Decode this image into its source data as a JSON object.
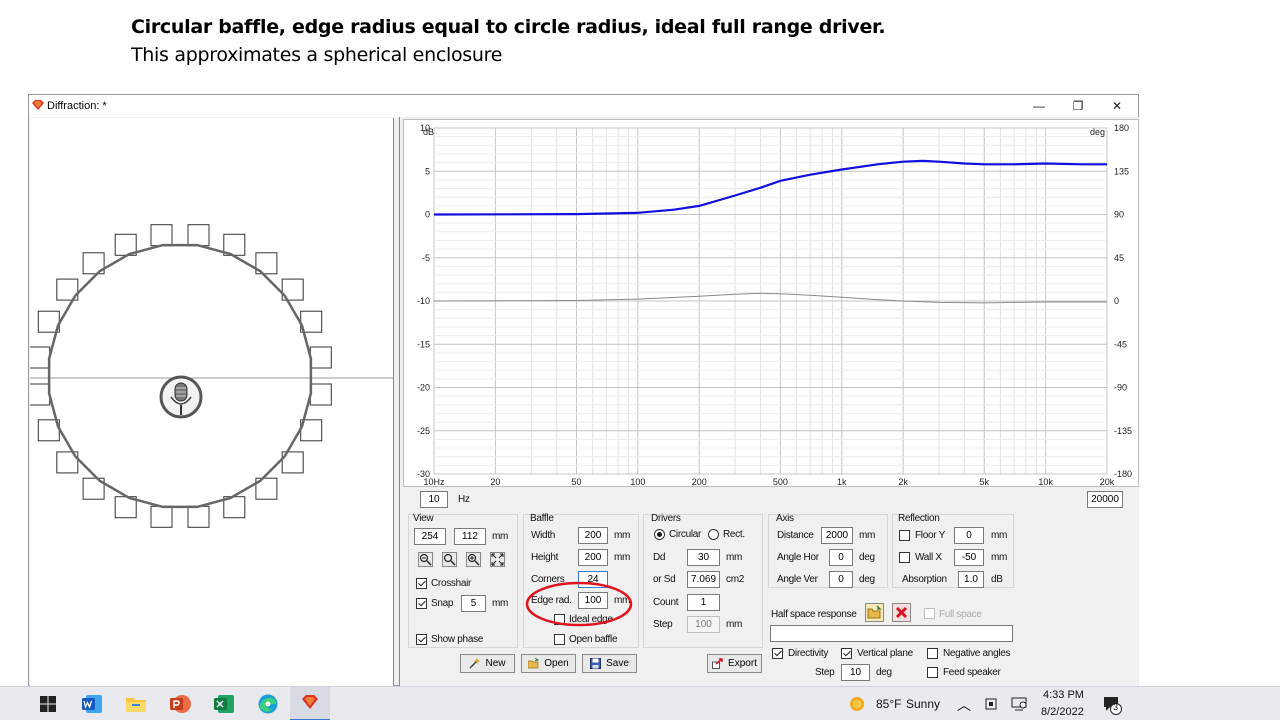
{
  "slide": {
    "title": "Circular baffle, edge radius equal to circle radius, ideal full range driver.",
    "subtitle": "This approximates a spherical enclosure"
  },
  "window": {
    "title": "Diffraction: *",
    "controls": [
      "—",
      "❐",
      "✕"
    ]
  },
  "graph": {
    "y_unit_left": "dB",
    "y_unit_right": "deg",
    "y_ticks_left": [
      "10",
      "5",
      "0",
      "-5",
      "-10",
      "-15",
      "-20",
      "-25",
      "-30"
    ],
    "y_ticks_right": [
      "180",
      "135",
      "90",
      "45",
      "0",
      "-45",
      "-90",
      "-135",
      "-180"
    ],
    "x_ticks": [
      "10Hz",
      "20",
      "50",
      "100",
      "200",
      "500",
      "1k",
      "2k",
      "5k",
      "10k",
      "20k"
    ],
    "freq_min": "10",
    "freq_min_unit": "Hz",
    "freq_max": "20000"
  },
  "chart_data": {
    "type": "line",
    "x_scale": "log",
    "xlim": [
      10,
      20000
    ],
    "ylim": [
      -30,
      10
    ],
    "y2lim": [
      -180,
      180
    ],
    "series": [
      {
        "axis": "left",
        "color": "#1010e0",
        "x": [
          10,
          50,
          100,
          150,
          200,
          300,
          400,
          500,
          700,
          1000,
          1500,
          2000,
          2500,
          3000,
          4000,
          5000,
          7000,
          10000,
          15000,
          20000
        ],
        "y": [
          0,
          0.05,
          0.2,
          0.55,
          1.0,
          2.2,
          3.1,
          3.9,
          4.6,
          5.2,
          5.8,
          6.1,
          6.2,
          6.1,
          5.9,
          5.8,
          5.8,
          5.9,
          5.8,
          5.8
        ]
      },
      {
        "axis": "right",
        "color": "#888888",
        "x": [
          10,
          50,
          100,
          200,
          300,
          400,
          500,
          700,
          1000,
          1500,
          2000,
          3000,
          5000,
          7000,
          10000,
          20000
        ],
        "y": [
          0,
          0.5,
          2,
          5,
          7,
          8,
          7.5,
          6,
          4,
          1.5,
          0,
          -1.5,
          -2,
          -1.5,
          -1,
          -1
        ]
      }
    ]
  },
  "view": {
    "label": "View",
    "width": "254",
    "height": "112",
    "unit": "mm",
    "crosshair_label": "Crosshair",
    "crosshair_checked": true,
    "snap_label": "Snap",
    "snap_checked": true,
    "snap_value": "5",
    "snap_unit": "mm",
    "show_phase_label": "Show phase",
    "show_phase_checked": true
  },
  "baffle": {
    "label": "Baffle",
    "width_label": "Width",
    "width": "200",
    "height_label": "Height",
    "height": "200",
    "unit": "mm",
    "corners_label": "Corners",
    "corners": "24",
    "edge_rad_label": "Edge rad.",
    "edge_rad": "100",
    "ideal_edge_label": "Ideal edge",
    "ideal_edge_checked": false,
    "open_baffle_label": "Open baffle",
    "open_baffle_checked": false
  },
  "drivers": {
    "label": "Drivers",
    "circular_label": "Circular",
    "rect_label": "Rect.",
    "circular_selected": true,
    "dd_label": "Dd",
    "dd": "30",
    "dd_unit": "mm",
    "sd_label": "or Sd",
    "sd": "7.069",
    "sd_unit": "cm2",
    "count_label": "Count",
    "count": "1",
    "step_label": "Step",
    "step": "100",
    "step_unit": "mm"
  },
  "axis": {
    "label": "Axis",
    "distance_label": "Distance",
    "distance": "2000",
    "distance_unit": "mm",
    "angle_hor_label": "Angle Hor",
    "angle_hor": "0",
    "angle_ver_label": "Angle Ver",
    "angle_ver": "0",
    "deg_unit": "deg"
  },
  "reflection": {
    "label": "Reflection",
    "floor_label": "Floor Y",
    "floor_checked": false,
    "floor_value": "0",
    "wall_label": "Wall  X",
    "wall_checked": false,
    "wall_value": "-50",
    "unit": "mm",
    "absorption_label": "Absorption",
    "absorption": "1.0",
    "absorption_unit": "dB"
  },
  "half_space": {
    "label": "Half space response",
    "full_space_label": "Full space",
    "full_space_checked": false,
    "path": ""
  },
  "options": {
    "directivity_label": "Directivity",
    "directivity_checked": true,
    "vertical_plane_label": "Vertical plane",
    "vertical_plane_checked": true,
    "negative_angles_label": "Negative angles",
    "negative_angles_checked": false,
    "step_label": "Step",
    "step": "10",
    "step_unit": "deg",
    "feed_speaker_label": "Feed speaker",
    "feed_speaker_checked": false
  },
  "buttons": {
    "new": "New",
    "open": "Open",
    "save": "Save",
    "export": "Export"
  },
  "taskbar": {
    "weather_temp": "85°F",
    "weather_text": "Sunny",
    "time": "4:33 PM",
    "date": "8/2/2022",
    "notif_count": "3"
  },
  "colors": {
    "accent_red": "#e0141e",
    "response_blue": "#1010e0",
    "phase_gray": "#888888"
  }
}
